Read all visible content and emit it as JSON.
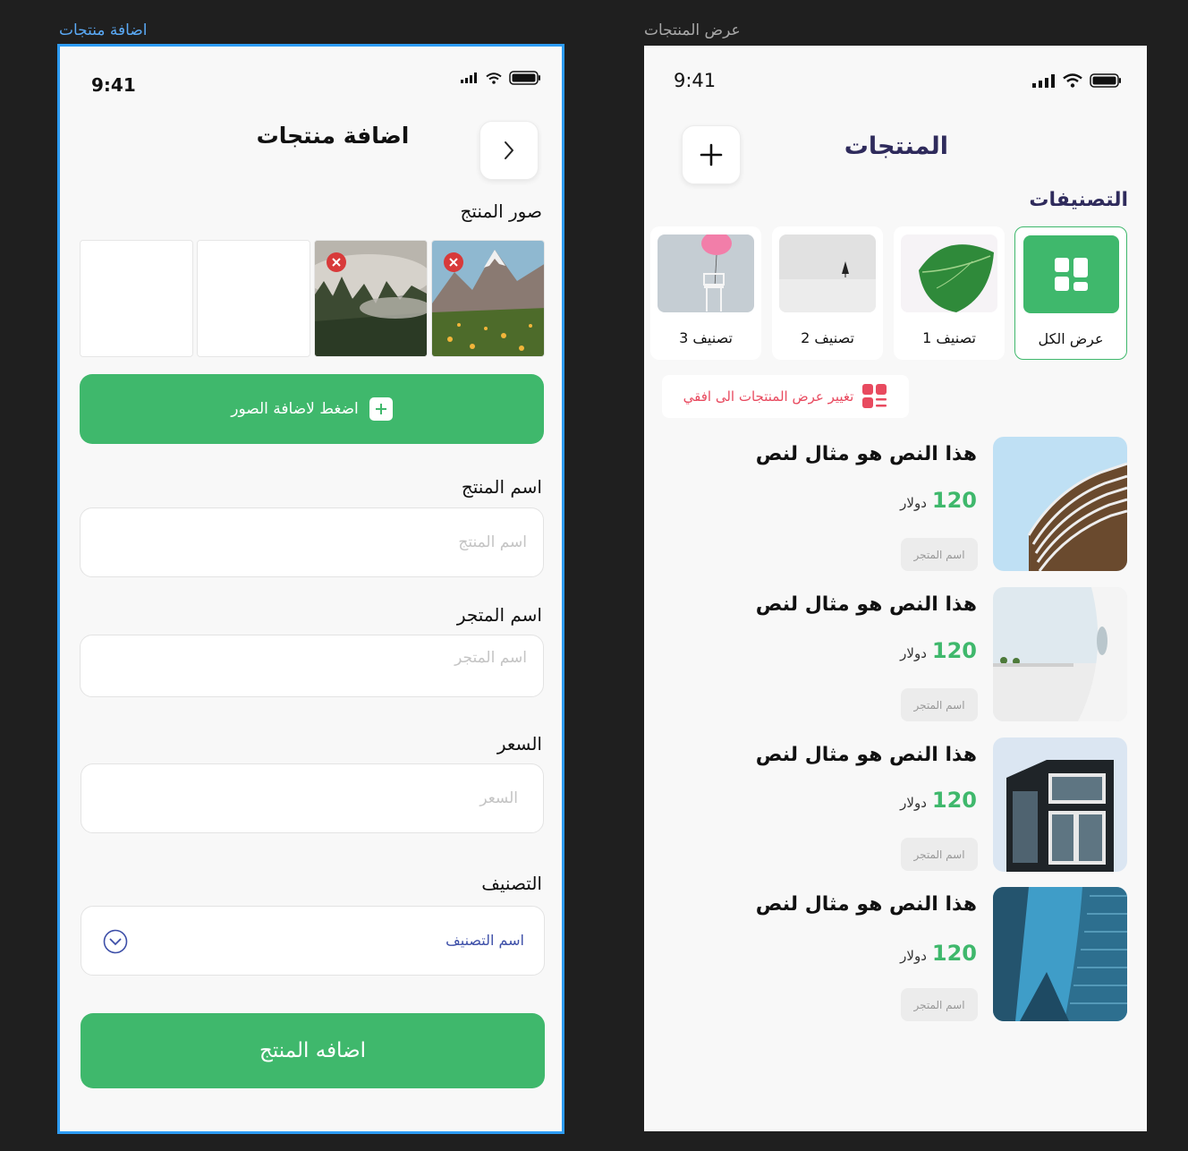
{
  "left_frame": {
    "frame_label": "اضافة منتجات",
    "status_time": "9:41",
    "title": "اضافة منتجات",
    "photos_label": "صور المنتج",
    "add_photos_button": "اضغط لاضافة الصور",
    "product_name_label": "اسم المنتج",
    "product_name_placeholder": "اسم المنتج",
    "store_name_label": "اسم المتجر",
    "store_name_placeholder": "اسم المتجر",
    "price_label": "السعر",
    "price_placeholder": "السعر",
    "category_label": "التصنيف",
    "category_value": "اسم التصنيف",
    "submit_button": "اضافه المنتج"
  },
  "right_frame": {
    "frame_label": "عرض المنتجات",
    "status_time": "9:41",
    "title": "المنتجات",
    "categories_label": "التصنيفات",
    "categories": [
      {
        "label": "عرض الكل",
        "active": true
      },
      {
        "label": "تصنيف 1",
        "active": false
      },
      {
        "label": "تصنيف 2",
        "active": false
      },
      {
        "label": "تصنيف 3",
        "active": false
      }
    ],
    "toggle_view_label": "تغيير عرض المنتجات الى افقي",
    "products": [
      {
        "title": "هذا النص هو مثال لنص",
        "price": "120",
        "currency": "دولار",
        "store": "اسم المتجر"
      },
      {
        "title": "هذا النص هو مثال لنص",
        "price": "120",
        "currency": "دولار",
        "store": "اسم المتجر"
      },
      {
        "title": "هذا النص هو مثال لنص",
        "price": "120",
        "currency": "دولار",
        "store": "اسم المتجر"
      },
      {
        "title": "هذا النص هو مثال لنص",
        "price": "120",
        "currency": "دولار",
        "store": "اسم المتجر"
      }
    ]
  },
  "colors": {
    "accent": "#3fb86c",
    "selection": "#2d9cf4",
    "danger": "#e84a5f",
    "heading": "#2f2b5c"
  }
}
